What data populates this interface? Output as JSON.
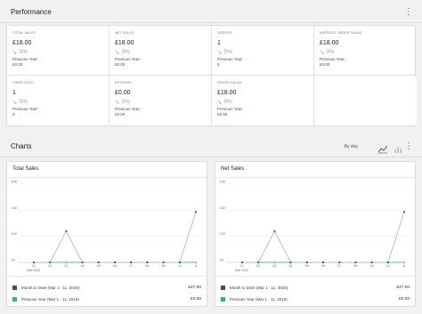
{
  "performance": {
    "title": "Performance",
    "cells": [
      {
        "label": "TOTAL SALES",
        "value": "£18.00",
        "delta": "0%",
        "prev_label": "Previous Year:",
        "prev_value": "£0.00"
      },
      {
        "label": "NET SALES",
        "value": "£18.00",
        "delta": "0%",
        "prev_label": "Previous Year:",
        "prev_value": "£0.00"
      },
      {
        "label": "ORDERS",
        "value": "1",
        "delta": "0%",
        "prev_label": "Previous Year:",
        "prev_value": "0"
      },
      {
        "label": "AVERAGE ORDER VALUE",
        "value": "£18.00",
        "delta": "0%",
        "prev_label": "Previous Year:",
        "prev_value": "£0.00"
      },
      {
        "label": "ITEMS SOLD",
        "value": "1",
        "delta": "0%",
        "prev_label": "Previous Year:",
        "prev_value": "0"
      },
      {
        "label": "RETURNS",
        "value": "£0.00",
        "delta": "0%",
        "prev_label": "Previous Year:",
        "prev_value": "£0.00"
      },
      {
        "label": "GROSS SALES",
        "value": "£18.00",
        "delta": "0%",
        "prev_label": "Previous Year:",
        "prev_value": "£0.00"
      }
    ]
  },
  "charts": {
    "title": "Charts",
    "interval": "By day"
  },
  "colors": {
    "current": "#2d5477",
    "previous": "#2bb97e",
    "line": "#a9bccd"
  },
  "chart_data": [
    {
      "type": "line",
      "title": "Total Sales",
      "x": [
        "",
        "",
        "",
        "",
        "",
        "",
        "",
        "",
        "",
        "",
        ""
      ],
      "xtick_labels": [
        "01",
        "02",
        "03",
        "04",
        "05",
        "06",
        "07",
        "08",
        "09",
        "10",
        "11"
      ],
      "x_sublabel": "Mar 2020",
      "y_ticks": [
        "£0",
        "£15",
        "£30",
        "£45"
      ],
      "ylim": [
        0,
        45
      ],
      "series": [
        {
          "name": "Month to Date (Mar 1 - 11, 2020)",
          "values": [
            0,
            0,
            18,
            0,
            0,
            0,
            0,
            0,
            0,
            0,
            29
          ],
          "total": "£47.00"
        },
        {
          "name": "Previous Year (Mar 1 - 11, 2019)",
          "values": [
            0,
            0,
            0,
            0,
            0,
            0,
            0,
            0,
            0,
            0,
            0
          ],
          "total": "£0.00"
        }
      ]
    },
    {
      "type": "line",
      "title": "Net Sales",
      "x": [
        "",
        "",
        "",
        "",
        "",
        "",
        "",
        "",
        "",
        "",
        ""
      ],
      "xtick_labels": [
        "01",
        "02",
        "03",
        "04",
        "05",
        "06",
        "07",
        "08",
        "09",
        "10",
        "11"
      ],
      "x_sublabel": "Mar 2020",
      "y_ticks": [
        "£0",
        "£15",
        "£30",
        "£45"
      ],
      "ylim": [
        0,
        45
      ],
      "series": [
        {
          "name": "Month to Date (Mar 1 - 11, 2020)",
          "values": [
            0,
            0,
            18,
            0,
            0,
            0,
            0,
            0,
            0,
            0,
            29
          ],
          "total": "£47.00"
        },
        {
          "name": "Previous Year (Mar 1 - 11, 2019)",
          "values": [
            0,
            0,
            0,
            0,
            0,
            0,
            0,
            0,
            0,
            0,
            0
          ],
          "total": "£0.00"
        }
      ]
    }
  ]
}
